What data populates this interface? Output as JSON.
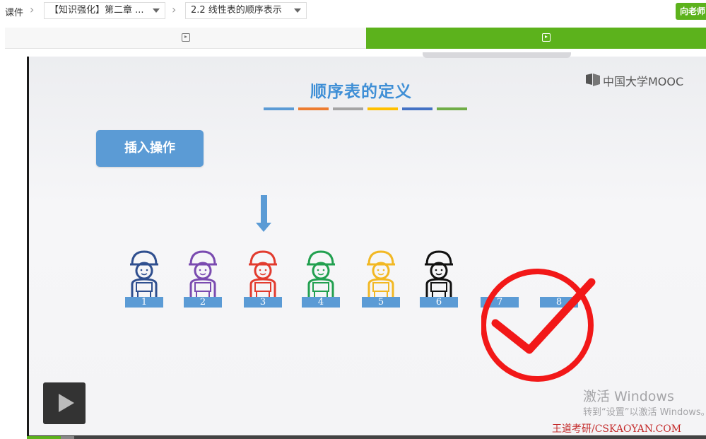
{
  "breadcrumb": {
    "root": "课件",
    "chapter": "【知识强化】第二章 ...",
    "section": "2.2 线性表的顺序表示"
  },
  "header": {
    "teacher_button": "向老师"
  },
  "tabs": [
    {
      "icon": "play-icon",
      "active": false
    },
    {
      "icon": "play-icon",
      "active": true
    }
  ],
  "slide": {
    "title": "顺序表的定义",
    "logo": "中国大学MOOC",
    "insert_label": "插入操作",
    "stripe_colors": [
      "#5b9bd5",
      "#ed7d31",
      "#a5a5a5",
      "#ffc000",
      "#4472c4",
      "#70ad47"
    ],
    "slots": [
      "1",
      "2",
      "3",
      "4",
      "5",
      "6",
      "7",
      "8"
    ],
    "people_colors": [
      "#2f4f8f",
      "#7a4bb0",
      "#e23b2e",
      "#22a050",
      "#f2b824",
      "#111111"
    ],
    "highlighted_slot": "3"
  },
  "player": {
    "play_icon": "play-icon",
    "progress": 0.05,
    "buffered": 0.07
  },
  "overlay": {
    "windows_activate": "激活 Windows",
    "windows_activate_sub": "转到“设置”以激活 Windows。",
    "watermark": "王道考研/CSKAOYAN.COM"
  }
}
